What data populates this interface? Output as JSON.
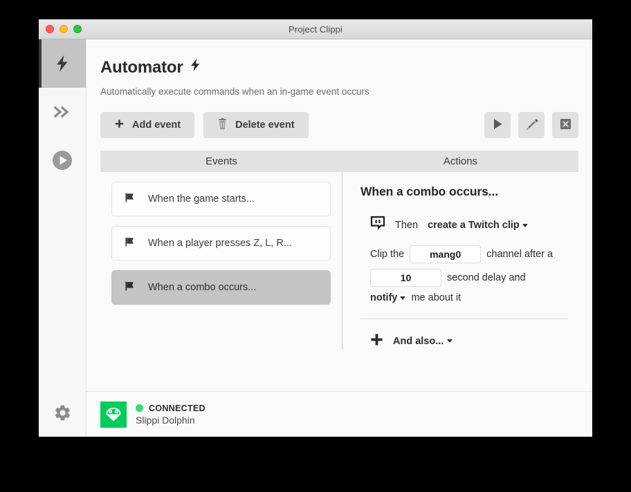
{
  "window": {
    "title": "Project Clippi",
    "traffic_lights": [
      {
        "name": "close",
        "color": "#ff5f57"
      },
      {
        "name": "minimize",
        "color": "#ffbd2e"
      },
      {
        "name": "maximize",
        "color": "#28c840"
      }
    ]
  },
  "sidebar": {
    "items": [
      {
        "id": "automator",
        "icon": "lightning-bolt-icon",
        "active": true
      },
      {
        "id": "expand",
        "icon": "double-chevron-right-icon",
        "active": false
      },
      {
        "id": "player",
        "icon": "play-circle-icon",
        "active": false
      }
    ],
    "bottom": {
      "id": "settings",
      "icon": "gear-icon"
    }
  },
  "page": {
    "title": "Automator",
    "title_icon": "lightning-bolt-icon",
    "subtitle": "Automatically execute commands when an in-game event occurs"
  },
  "toolbar": {
    "add_event_label": "Add event",
    "add_event_icon": "plus-icon",
    "delete_event_label": "Delete event",
    "delete_event_icon": "trash-icon",
    "icon_buttons": [
      {
        "name": "run-button",
        "icon": "play-icon"
      },
      {
        "name": "edit-button",
        "icon": "pencil-icon"
      },
      {
        "name": "clear-button",
        "icon": "close-box-icon"
      }
    ]
  },
  "columns": {
    "events_header": "Events",
    "actions_header": "Actions"
  },
  "events": [
    {
      "icon": "flag-icon",
      "label": "When the game starts...",
      "selected": false
    },
    {
      "icon": "flag-icon",
      "label": "When a player presses Z, L, R...",
      "selected": false
    },
    {
      "icon": "flag-icon",
      "label": "When a combo occurs...",
      "selected": true
    }
  ],
  "actions": {
    "title": "When a combo occurs...",
    "action_icon": "twitch-icon",
    "then_prefix": "Then",
    "then_action": "create a Twitch clip",
    "line1_prefix": "Clip the",
    "channel_value": "mang0",
    "channel_placeholder": "channel name",
    "line1_suffix": "channel after a",
    "delay_value": "10",
    "delay_placeholder": "0",
    "line2_suffix": "second delay and",
    "notify_label": "notify",
    "line3_suffix": "me about it",
    "and_also_label": "And also...",
    "and_also_icon": "plus-icon"
  },
  "status": {
    "logo_icon": "slippi-dolphin-icon",
    "logo_color": "#03cc5c",
    "indicator_color": "#2ce06a",
    "state": "CONNECTED",
    "source": "Slippi Dolphin"
  }
}
